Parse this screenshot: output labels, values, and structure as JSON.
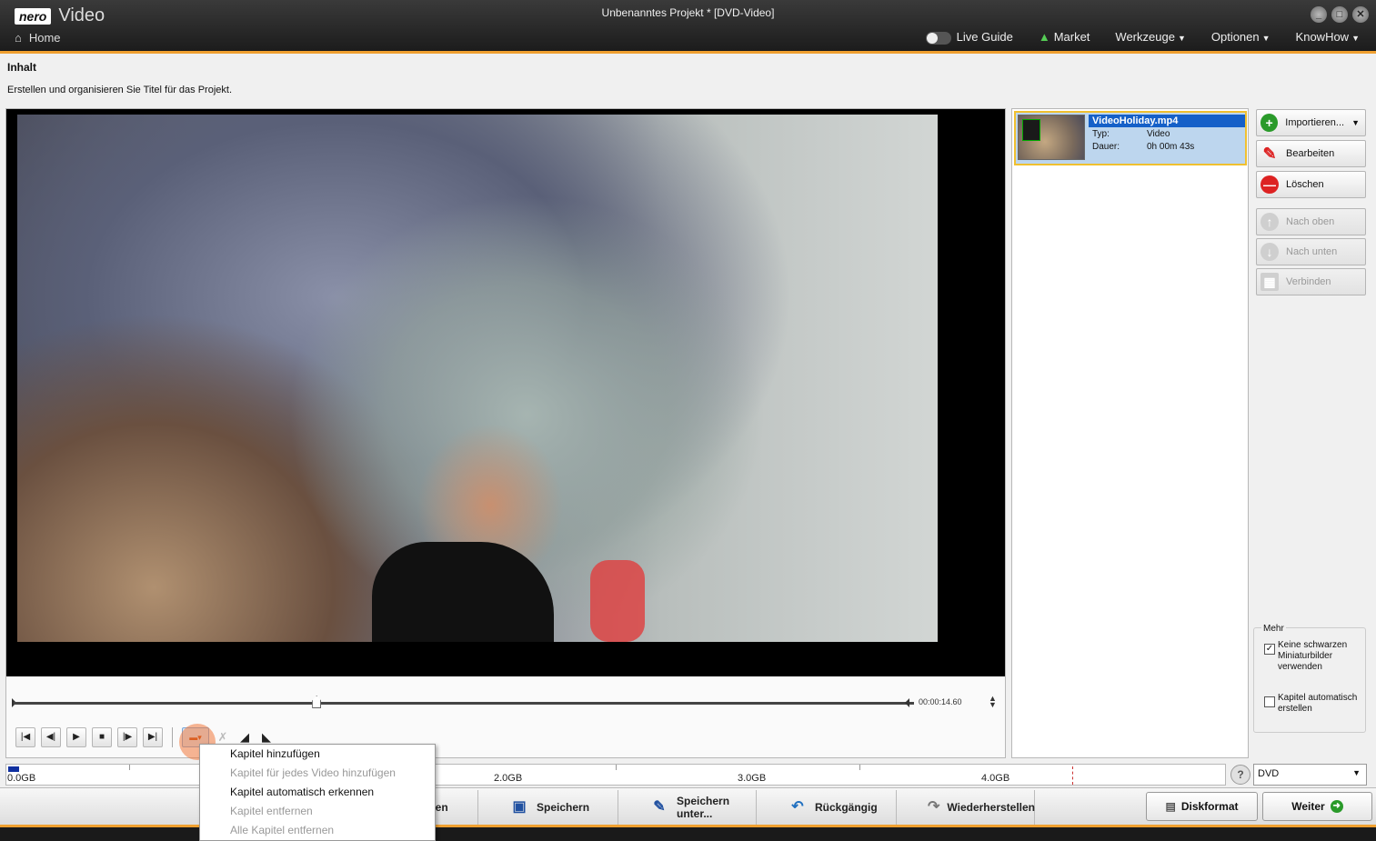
{
  "app": {
    "logo_brand": "nero",
    "logo_product": "Video",
    "window_title": "Unbenanntes Projekt * [DVD-Video]",
    "home_label": "Home",
    "window_buttons": [
      "_",
      "□",
      "✕"
    ]
  },
  "topnav": {
    "live_guide": "Live Guide",
    "market": "Market",
    "werkzeuge": "Werkzeuge",
    "optionen": "Optionen",
    "knowhow": "KnowHow"
  },
  "content": {
    "heading": "Inhalt",
    "subtitle": "Erstellen und organisieren Sie Titel für das Projekt."
  },
  "player": {
    "timecode": "00:00:14.60",
    "position_fraction": 0.34
  },
  "titles": [
    {
      "name": "VideoHoliday.mp4",
      "type_label": "Typ:",
      "type_value": "Video",
      "duration_label": "Dauer:",
      "duration_value": "0h 00m 43s"
    }
  ],
  "side_buttons": {
    "import": "Importieren...",
    "edit": "Bearbeiten",
    "delete": "Löschen",
    "up": "Nach oben",
    "down": "Nach unten",
    "join": "Verbinden"
  },
  "more": {
    "label": "Mehr",
    "opt1": "Keine schwarzen Miniaturbilder verwenden",
    "opt1_checked": true,
    "opt2": "Kapitel automatisch erstellen",
    "opt2_checked": false
  },
  "capacity": {
    "labels": [
      "0.0GB",
      "2.0GB",
      "3.0GB",
      "4.0GB"
    ],
    "disc_type": "DVD"
  },
  "bottom": {
    "hidden_partial": "ren",
    "save": "Speichern",
    "save_as": "Speichern unter...",
    "undo": "Rückgängig",
    "redo": "Wiederherstellen",
    "disc_format": "Diskformat",
    "next": "Weiter"
  },
  "context_menu": {
    "items": [
      {
        "label": "Kapitel hinzufügen",
        "enabled": true
      },
      {
        "label": "Kapitel für jedes Video hinzufügen",
        "enabled": false
      },
      {
        "label": "Kapitel automatisch erkennen",
        "enabled": true
      },
      {
        "label": "Kapitel entfernen",
        "enabled": false
      },
      {
        "label": "Alle Kapitel entfernen",
        "enabled": false
      }
    ]
  },
  "colors": {
    "accent_orange": "#f0a030",
    "selection_blue": "#1560c8"
  }
}
